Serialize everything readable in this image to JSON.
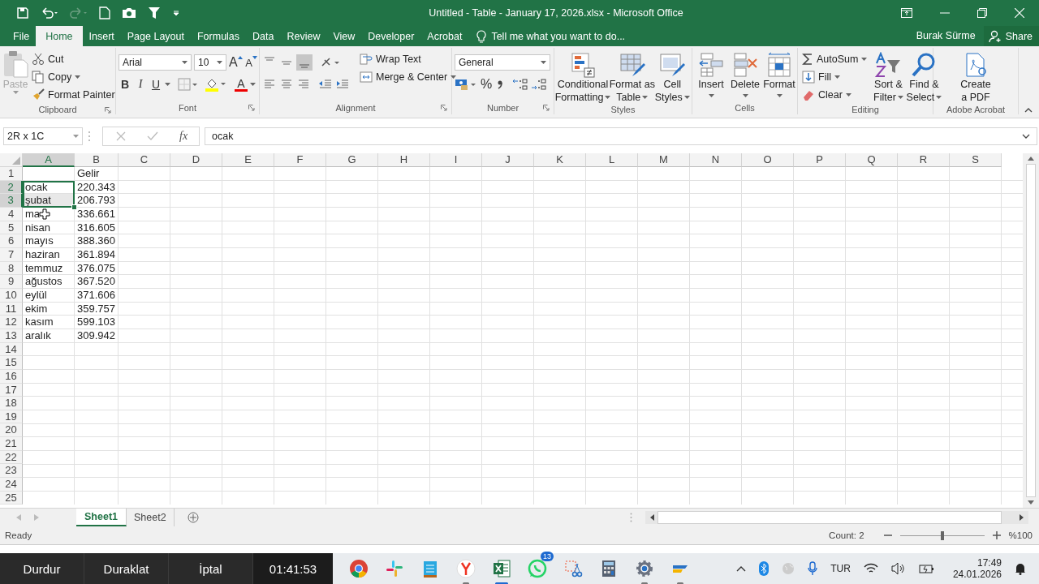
{
  "window": {
    "title": "Untitled - Table - January 17, 2026.xlsx - Microsoft Office"
  },
  "menu_tabs": [
    {
      "label": "File",
      "selected": false
    },
    {
      "label": "Home",
      "selected": true
    },
    {
      "label": "Insert",
      "selected": false
    },
    {
      "label": "Page Layout",
      "selected": false
    },
    {
      "label": "Formulas",
      "selected": false
    },
    {
      "label": "Data",
      "selected": false
    },
    {
      "label": "Review",
      "selected": false
    },
    {
      "label": "View",
      "selected": false
    },
    {
      "label": "Developer",
      "selected": false
    },
    {
      "label": "Acrobat",
      "selected": false
    }
  ],
  "tell_me": {
    "placeholder": "Tell me what you want to do..."
  },
  "account": {
    "user": "Burak Sürme",
    "share": "Share"
  },
  "ribbon": [
    {
      "kind": "clipboard",
      "label": "Clipboard",
      "paste": "Paste",
      "paste_disabled": true,
      "cut": "Cut",
      "copy": "Copy",
      "format_painter": "Format Painter"
    },
    {
      "kind": "font",
      "label": "Font",
      "font_name": "Arial",
      "font_size": "10",
      "grow": "A",
      "shrink": "A",
      "bold": "B",
      "italic": "I",
      "underline": "U",
      "font_color": "A"
    },
    {
      "kind": "alignment",
      "label": "Alignment",
      "align_bottom_on": true,
      "wrap_text": "Wrap Text",
      "merge_center": "Merge & Center"
    },
    {
      "kind": "number",
      "label": "Number",
      "format": "General",
      "percent": "%"
    },
    {
      "kind": "styles",
      "label": "Styles",
      "buttons": [
        {
          "kind": "conditional",
          "lines": [
            "Conditional",
            "Formatting"
          ],
          "dropdown": true
        },
        {
          "kind": "table",
          "lines": [
            "Format as",
            "Table"
          ],
          "dropdown": true
        },
        {
          "kind": "cell-styles",
          "lines": [
            "Cell",
            "Styles"
          ],
          "dropdown": true
        }
      ]
    },
    {
      "kind": "cells",
      "label": "Cells",
      "buttons": [
        {
          "kind": "insert",
          "lines": [
            "Insert"
          ],
          "dropdown": true
        },
        {
          "kind": "delete",
          "lines": [
            "Delete"
          ],
          "dropdown": true
        },
        {
          "kind": "format",
          "lines": [
            "Format"
          ],
          "dropdown": true
        }
      ]
    },
    {
      "kind": "editing",
      "label": "Editing",
      "autosum": "AutoSum",
      "fill": "Fill",
      "clear": "Clear",
      "buttons": [
        {
          "kind": "sort",
          "lines": [
            "Sort &",
            "Filter"
          ],
          "dropdown": true
        },
        {
          "kind": "find",
          "lines": [
            "Find &",
            "Select"
          ],
          "dropdown": true
        }
      ]
    },
    {
      "kind": "acrobat",
      "label": "Adobe Acrobat",
      "buttons": [
        {
          "kind": "pdf",
          "lines": [
            "Create",
            "a PDF"
          ],
          "dropdown": false
        }
      ]
    }
  ],
  "formula_bar": {
    "name_box": "2R x 1C",
    "fx": "fx",
    "value": "ocak"
  },
  "sheet": {
    "columns": [
      {
        "label": "A",
        "selected": true
      },
      {
        "label": "B",
        "selected": false
      },
      {
        "label": "C",
        "selected": false
      },
      {
        "label": "D",
        "selected": false
      },
      {
        "label": "E",
        "selected": false
      },
      {
        "label": "F",
        "selected": false
      },
      {
        "label": "G",
        "selected": false
      },
      {
        "label": "H",
        "selected": false
      },
      {
        "label": "I",
        "selected": false
      },
      {
        "label": "J",
        "selected": false
      },
      {
        "label": "K",
        "selected": false
      },
      {
        "label": "L",
        "selected": false
      },
      {
        "label": "M",
        "selected": false
      },
      {
        "label": "N",
        "selected": false
      },
      {
        "label": "O",
        "selected": false
      },
      {
        "label": "P",
        "selected": false
      },
      {
        "label": "Q",
        "selected": false
      },
      {
        "label": "R",
        "selected": false
      },
      {
        "label": "S",
        "selected": false
      }
    ],
    "rows": [
      {
        "label": "1",
        "selected": false,
        "b": "Gelir"
      },
      {
        "label": "2",
        "selected": true,
        "a": "ocak",
        "b": "220.343"
      },
      {
        "label": "3",
        "selected": true,
        "a": "şubat",
        "b": "206.793"
      },
      {
        "label": "4",
        "selected": false,
        "a": "ma",
        "b": "336.661"
      },
      {
        "label": "5",
        "selected": false,
        "a": "nisan",
        "b": "316.605"
      },
      {
        "label": "6",
        "selected": false,
        "a": "mayıs",
        "b": "388.360"
      },
      {
        "label": "7",
        "selected": false,
        "a": "haziran",
        "b": "361.894"
      },
      {
        "label": "8",
        "selected": false,
        "a": "temmuz",
        "b": "376.075"
      },
      {
        "label": "9",
        "selected": false,
        "a": "ağustos",
        "b": "367.520"
      },
      {
        "label": "10",
        "selected": false,
        "a": "eylül",
        "b": "371.606"
      },
      {
        "label": "11",
        "selected": false,
        "a": "ekim",
        "b": "359.757"
      },
      {
        "label": "12",
        "selected": false,
        "a": "kasım",
        "b": "599.103"
      },
      {
        "label": "13",
        "selected": false,
        "a": "aralık",
        "b": "309.942"
      },
      {
        "label": "14",
        "selected": false
      },
      {
        "label": "15",
        "selected": false
      },
      {
        "label": "16",
        "selected": false
      },
      {
        "label": "17",
        "selected": false
      },
      {
        "label": "18",
        "selected": false
      },
      {
        "label": "19",
        "selected": false
      },
      {
        "label": "20",
        "selected": false
      },
      {
        "label": "21",
        "selected": false
      },
      {
        "label": "22",
        "selected": false
      },
      {
        "label": "23",
        "selected": false
      },
      {
        "label": "24",
        "selected": false
      },
      {
        "label": "25",
        "selected": false
      }
    ]
  },
  "sheet_tabs": [
    {
      "label": "Sheet1",
      "selected": true
    },
    {
      "label": "Sheet2",
      "selected": false
    }
  ],
  "status": {
    "mode": "Ready",
    "count": "Count: 2",
    "zoom_slider": {
      "level": 0.5
    },
    "zoom": "%100"
  },
  "taskbar": {
    "recorder": [
      "Durdur",
      "Duraklat",
      "İptal"
    ],
    "timer": "01:41:53",
    "whatsapp_badge": "13",
    "language": "TUR",
    "time": "17:49",
    "date": "24.01.2026"
  }
}
